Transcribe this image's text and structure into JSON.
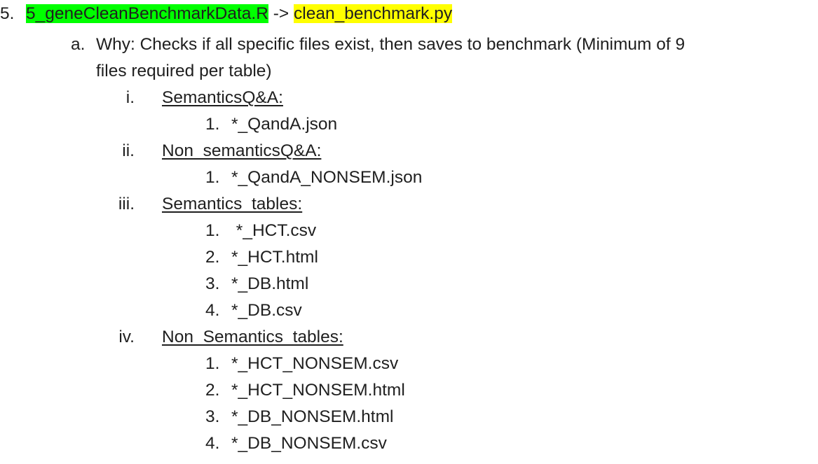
{
  "item5": {
    "marker": "5.",
    "source_file": "5_geneCleanBenchmarkData.R",
    "arrow": " -> ",
    "target_file": "clean_benchmark.py"
  },
  "item_a": {
    "marker": "a.",
    "text_line1": "Why: Checks if all specific files exist, then saves to benchmark (Minimum of 9",
    "text_line2": "files required per table)"
  },
  "sections": [
    {
      "marker": "i.",
      "heading": "SemanticsQ&A:",
      "files": [
        {
          "marker": "1.",
          "name": "*_QandA.json"
        }
      ]
    },
    {
      "marker": "ii.",
      "heading": "Non_semanticsQ&A:",
      "files": [
        {
          "marker": "1.",
          "name": "*_QandA_NONSEM.json"
        }
      ]
    },
    {
      "marker": "iii.",
      "heading": "Semantics_tables:",
      "files": [
        {
          "marker": "1.",
          "name": " *_HCT.csv"
        },
        {
          "marker": "2.",
          "name": "*_HCT.html"
        },
        {
          "marker": "3.",
          "name": "*_DB.html"
        },
        {
          "marker": "4.",
          "name": "*_DB.csv"
        }
      ]
    },
    {
      "marker": "iv.",
      "heading": "Non_Semantics_tables:",
      "files": [
        {
          "marker": "1.",
          "name": "*_HCT_NONSEM.csv"
        },
        {
          "marker": "2.",
          "name": "*_HCT_NONSEM.html"
        },
        {
          "marker": "3.",
          "name": "*_DB_NONSEM.html"
        },
        {
          "marker": "4.",
          "name": "*_DB_NONSEM.csv"
        }
      ]
    }
  ],
  "colors": {
    "highlight_green": "#00ff00",
    "highlight_yellow": "#ffff00",
    "text": "#1f1f1f"
  }
}
